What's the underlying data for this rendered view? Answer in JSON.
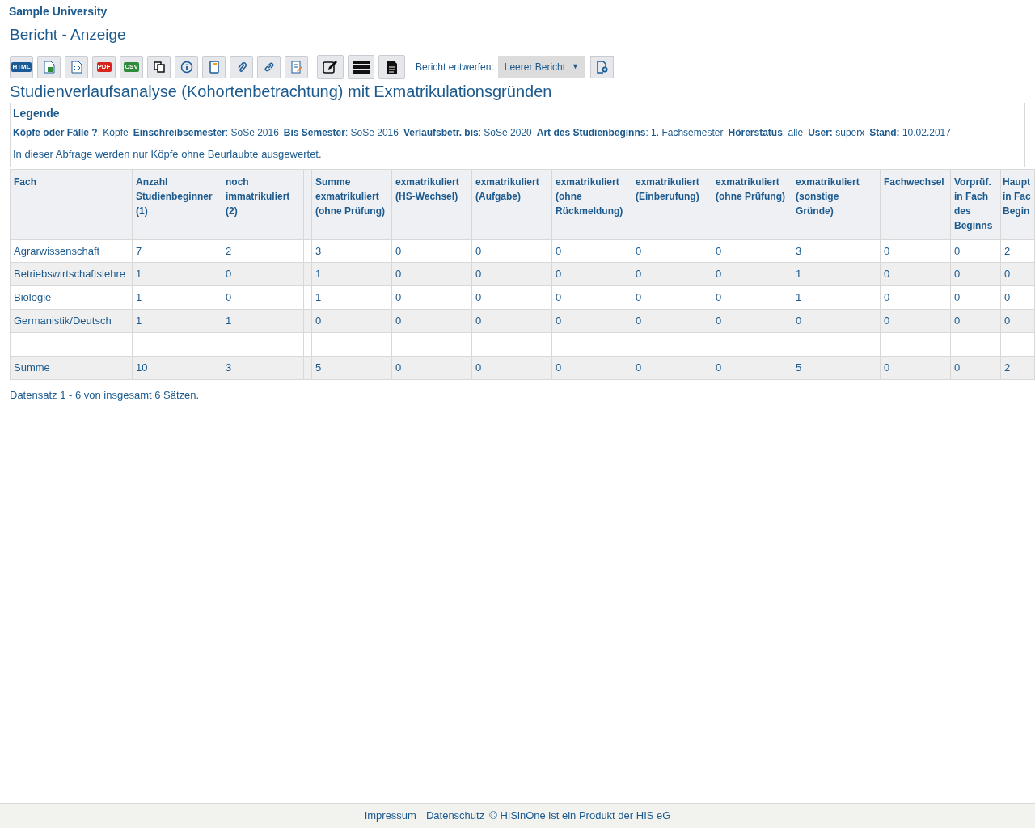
{
  "header": {
    "institution": "Sample University",
    "page_title": "Bericht - Anzeige"
  },
  "toolbar": {
    "buttons": [
      {
        "kind": "html",
        "badge": "HTML"
      },
      {
        "kind": "xls"
      },
      {
        "kind": "xml"
      },
      {
        "kind": "pdf",
        "badge": "PDF"
      },
      {
        "kind": "csv",
        "badge": "CSV"
      },
      {
        "kind": "copy"
      },
      {
        "kind": "info"
      },
      {
        "kind": "notebook"
      },
      {
        "kind": "attach"
      },
      {
        "kind": "link"
      },
      {
        "kind": "edit-doc"
      },
      {
        "kind": "pencil"
      },
      {
        "kind": "rows"
      },
      {
        "kind": "document"
      }
    ],
    "design_label": "Bericht entwerfen:",
    "design_select": "Leerer Bericht",
    "select_arrow": "▼"
  },
  "report_title": "Studienverlaufsanalyse (Kohortenbetrachtung) mit Exmatrikulationsgründen",
  "legend": {
    "title": "Legende",
    "items": [
      "**Köpfe oder Fälle ?**: Köpfe",
      "**Einschreibsemester**: SoSe 2016",
      "**Bis Semester**: SoSe 2016",
      "**Verlaufsbetr. bis**: SoSe 2020",
      "**Art des Studienbeginns**: 1. Fachsemester",
      "**Hörerstatus**: alle",
      "**User:** superx",
      "**Stand:** 10.02.2017"
    ],
    "note": "In dieser Abfrage werden nur Köpfe ohne Beurlaubte ausgewertet."
  },
  "table": {
    "columns": [
      {
        "kind": "data",
        "label": "Fach"
      },
      {
        "kind": "data",
        "label": "Anzahl Studienbeginner (1)"
      },
      {
        "kind": "data",
        "label": "noch immatrikuliert (2)"
      },
      {
        "kind": "spacer"
      },
      {
        "kind": "data",
        "label": "Summe exmatrikuliert (ohne Prüfung)"
      },
      {
        "kind": "data",
        "label": "exmatrikuliert (HS-Wechsel)"
      },
      {
        "kind": "data",
        "label": "exmatrikuliert (Aufgabe)"
      },
      {
        "kind": "data",
        "label": "exmatrikuliert (ohne Rückmeldung)"
      },
      {
        "kind": "data",
        "label": "exmatrikuliert (Einberufung)"
      },
      {
        "kind": "data",
        "label": "exmatrikuliert (ohne Prüfung)"
      },
      {
        "kind": "data",
        "label": "exmatrikuliert (sonstige Gründe)"
      },
      {
        "kind": "spacer"
      },
      {
        "kind": "data",
        "label": "Fachwechsel"
      },
      {
        "kind": "data",
        "label": "Vorprüf. in Fach des Beginns"
      },
      {
        "kind": "data",
        "label": "Haupt in Fac Begin"
      }
    ],
    "rows": [
      {
        "kind": "data",
        "cells": [
          "Agrarwissenschaft",
          "7",
          "2",
          "3",
          "0",
          "0",
          "0",
          "0",
          "0",
          "3",
          "0",
          "0",
          "2"
        ]
      },
      {
        "kind": "data",
        "cells": [
          "Betriebswirtschaftslehre",
          "1",
          "0",
          "1",
          "0",
          "0",
          "0",
          "0",
          "0",
          "1",
          "0",
          "0",
          "0"
        ]
      },
      {
        "kind": "data",
        "cells": [
          "Biologie",
          "1",
          "0",
          "1",
          "0",
          "0",
          "0",
          "0",
          "0",
          "1",
          "0",
          "0",
          "0"
        ]
      },
      {
        "kind": "data",
        "cells": [
          "Germanistik/Deutsch",
          "1",
          "1",
          "0",
          "0",
          "0",
          "0",
          "0",
          "0",
          "0",
          "0",
          "0",
          "0"
        ]
      },
      {
        "kind": "blank"
      },
      {
        "kind": "data",
        "cells": [
          "Summe",
          "10",
          "3",
          "5",
          "0",
          "0",
          "0",
          "0",
          "0",
          "5",
          "0",
          "0",
          "2"
        ]
      }
    ],
    "record_info": "Datensatz 1 - 6 von insgesamt 6 Sätzen."
  },
  "footer": {
    "links": [
      "Impressum",
      "Datenschutz"
    ],
    "copyright": "© HISinOne ist ein Produkt der HIS eG"
  }
}
